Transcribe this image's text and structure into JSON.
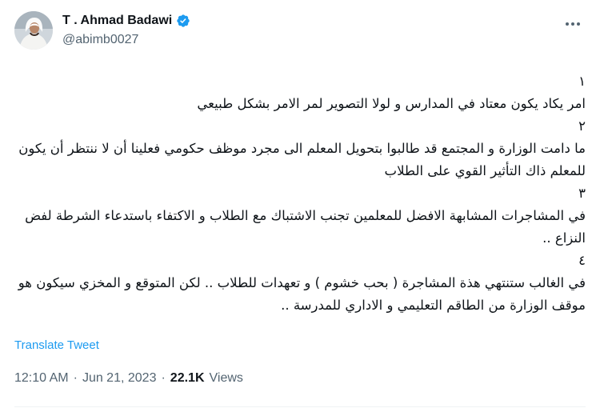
{
  "author": {
    "display_name": "T . Ahmad Badawi",
    "handle": "@abimb0027",
    "verified": true
  },
  "tweet": {
    "paragraphs": [
      "١",
      "امر يكاد يكون معتاد في المدارس و لولا التصوير لمر الامر بشكل طبيعي",
      "٢",
      "ما دامت الوزارة و المجتمع قد طالبوا بتحويل المعلم الى مجرد موظف حكومي فعلينا أن لا ننتظر أن يكون للمعلم ذاك التأثير القوي على الطلاب",
      "٣",
      "في المشاجرات المشابهة الافضل للمعلمين تجنب الاشتباك مع الطلاب و الاكتفاء باستدعاء الشرطة لفض النزاع ..",
      "٤",
      "في الغالب ستنتهي هذة المشاجرة ( بحب خشوم ) و تعهدات للطلاب .. لكن المتوقع و المخزي سيكون هو موقف الوزارة من الطاقم التعليمي و الاداري للمدرسة .."
    ],
    "translate_label": "Translate Tweet",
    "time": "12:10 AM",
    "separator": "·",
    "date": "Jun 21, 2023",
    "views_count": "22.1K",
    "views_label": "Views"
  },
  "colors": {
    "accent": "#1d9bf0",
    "secondary_text": "#536471",
    "primary_text": "#0f1419"
  },
  "icons": {
    "verified": "verified-badge-icon",
    "more": "more-options-icon"
  }
}
